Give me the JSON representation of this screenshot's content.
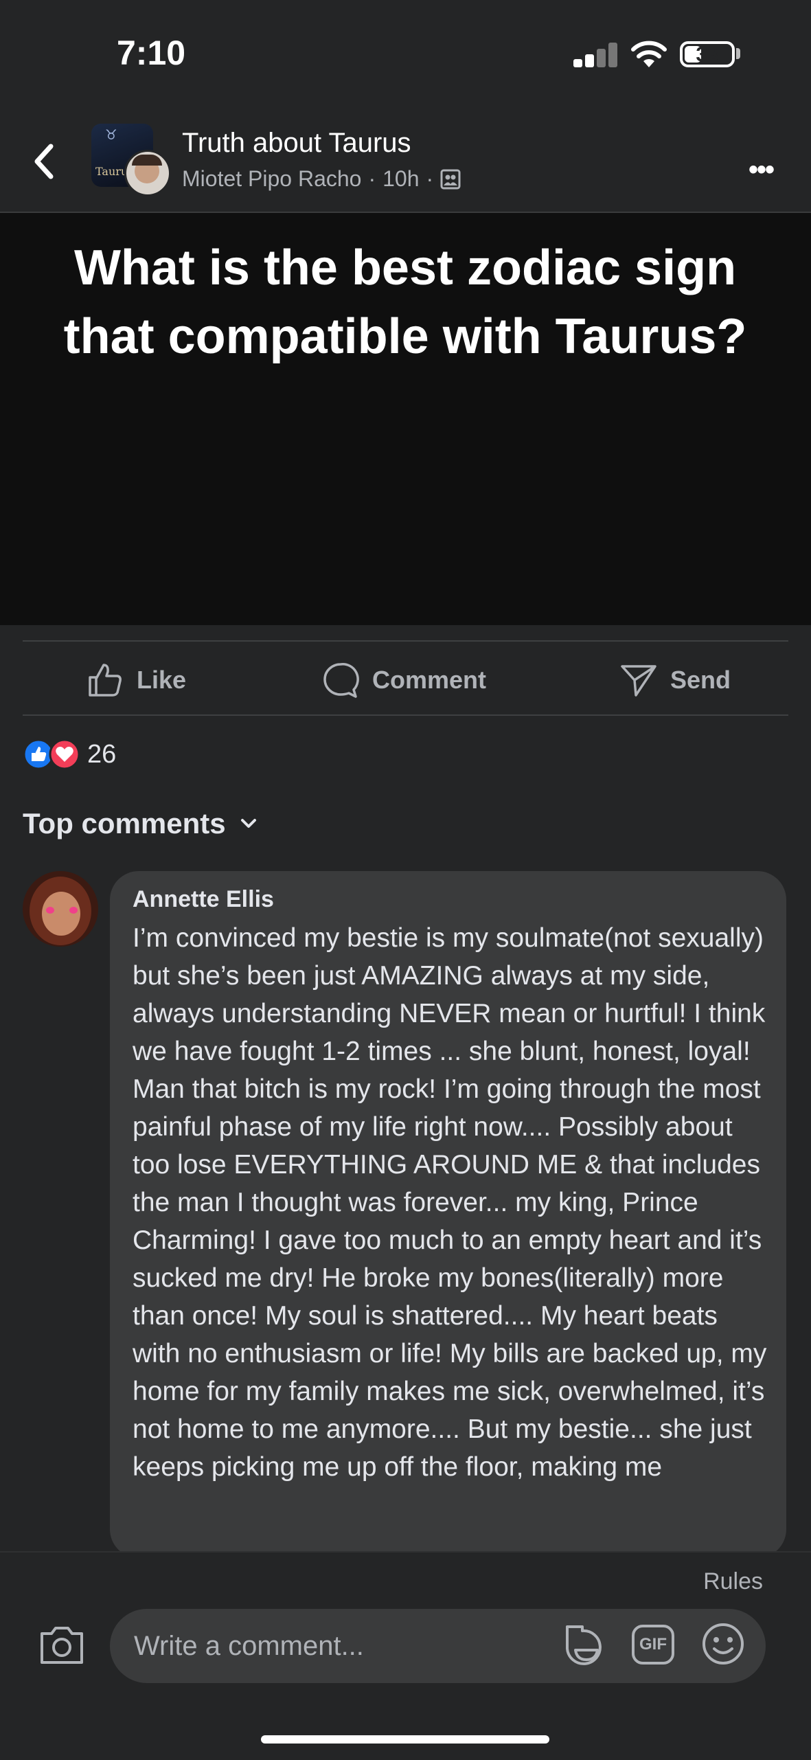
{
  "status_bar": {
    "time": "7:10",
    "battery": "33"
  },
  "header": {
    "group_name": "Truth about Taurus",
    "author": "Miotet Pipo Racho",
    "separator": "·",
    "time_ago": "10h",
    "avatar_label": "Taurus"
  },
  "post": {
    "title": "What is the best zodiac sign that compatible with Taurus?"
  },
  "actions": {
    "like": "Like",
    "comment": "Comment",
    "send": "Send"
  },
  "reactions": {
    "count": "26"
  },
  "comments_section": {
    "sort_label": "Top comments"
  },
  "comment": {
    "author": "Annette Ellis",
    "text": "I’m convinced my bestie is my soulmate(not sexually) but she’s been just AMAZING always at my side, always understanding NEVER mean or hurtful! I think we have fought 1-2 times ... she blunt, honest, loyal! Man that bitch is my rock! I’m going through the most painful phase of my life right now.... Possibly about too lose EVERYTHING AROUND ME & that includes the man I thought was forever... my king, Prince Charming! I gave too much to an empty heart and it’s sucked me dry! He broke my bones(literally) more than once! My soul is shattered.... My heart beats with no enthusiasm or life! My bills are backed up, my home for my family makes me sick, overwhelmed, it’s not home to me anymore.... But my bestie... she just keeps picking me up off the floor, making me"
  },
  "composer": {
    "rules": "Rules",
    "placeholder": "Write a comment...",
    "gif": "GIF"
  },
  "colors": {
    "background": "#242526",
    "post_bg": "#0f0f0f",
    "like_blue": "#1877f2",
    "love_red": "#f33e58"
  }
}
